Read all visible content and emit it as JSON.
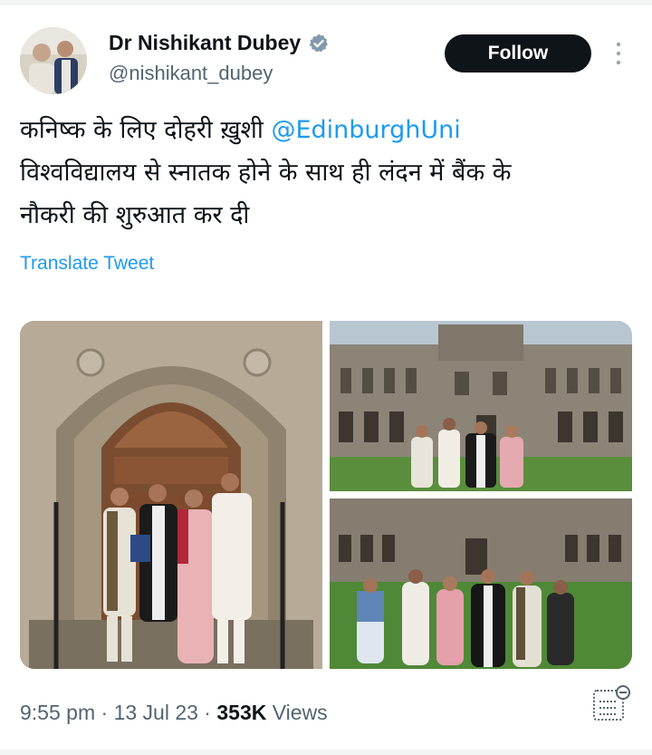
{
  "author": {
    "name": "Dr Nishikant Dubey",
    "handle": "@nishikant_dubey",
    "verified_icon": "verified-badge-icon"
  },
  "actions": {
    "follow_label": "Follow",
    "more_icon": "more-vertical-icon"
  },
  "tweet": {
    "line1_text": "कनिष्क के लिए दोहरी ख़ुशी ",
    "mention": "@EdinburghUni",
    "line2": "विश्वविद्यालय से स्नातक होने के साथ ही लंदन में बैंक के",
    "line3": "नौकरी की शुरुआत कर दी",
    "translate_label": "Translate Tweet"
  },
  "meta": {
    "time": "9:55 pm",
    "sep": " · ",
    "date": "13 Jul 23",
    "views_count": "353K",
    "views_label": " Views",
    "analytics_icon": "analytics-icon"
  },
  "colors": {
    "link": "#1d9bf0",
    "text": "#0f1419",
    "secondary": "#536471",
    "button_bg": "#0f1419"
  }
}
